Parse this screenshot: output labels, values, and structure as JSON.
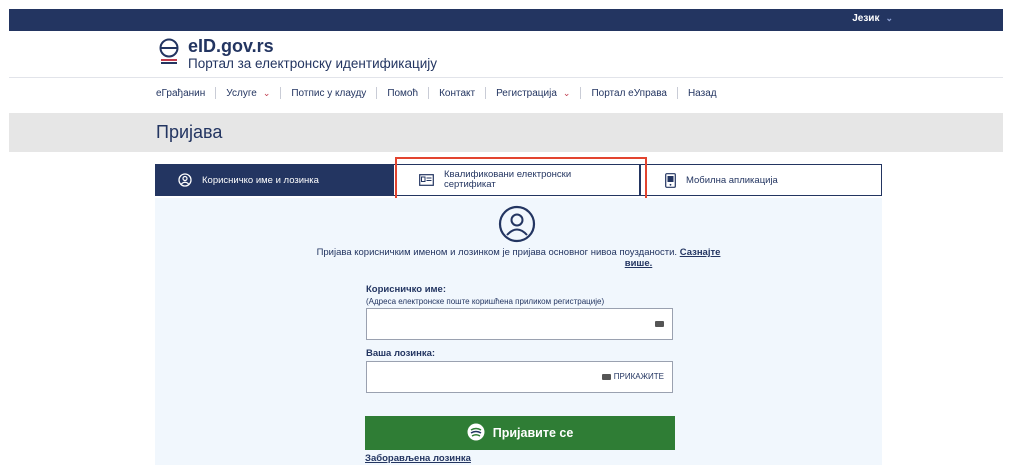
{
  "topbar": {
    "language_label": "Језик"
  },
  "header": {
    "title": "eID.gov.rs",
    "subtitle": "Портал за електронску идентификацију"
  },
  "nav": {
    "items": [
      {
        "label": "eГрађанин",
        "dropdown": false
      },
      {
        "label": "Услуге",
        "dropdown": true
      },
      {
        "label": "Потпис у клауду",
        "dropdown": false
      },
      {
        "label": "Помоћ",
        "dropdown": false
      },
      {
        "label": "Контакт",
        "dropdown": false
      },
      {
        "label": "Регистрација",
        "dropdown": true
      },
      {
        "label": "Портал еУправа",
        "dropdown": false
      },
      {
        "label": "Назад",
        "dropdown": false
      }
    ]
  },
  "page": {
    "title": "Пријава"
  },
  "tabs": {
    "username": "Корисничко име и лозинка",
    "cert_line1": "Квалификовани електронски",
    "cert_line2": "сертификат",
    "mobile": "Мобилна апликација"
  },
  "form": {
    "info_text": "Пријава корисничким именом и лозинком је пријава основног нивоа поузданости.",
    "info_link_1": "Сазнајте",
    "info_link_2": "више.",
    "username_label": "Корисничко име:",
    "username_hint": "(Адреса електронске поште коришћена приликом регистрације)",
    "username_value": "",
    "password_label": "Ваша лозинка:",
    "password_value": "",
    "show_label": "ПРИКАЖИТЕ",
    "submit_label": "Пријавите се",
    "forgot_label": "Заборављена лозинка"
  },
  "colors": {
    "brand_navy": "#233561",
    "submit_green": "#2f7d35",
    "highlight_red": "#e2442f"
  }
}
